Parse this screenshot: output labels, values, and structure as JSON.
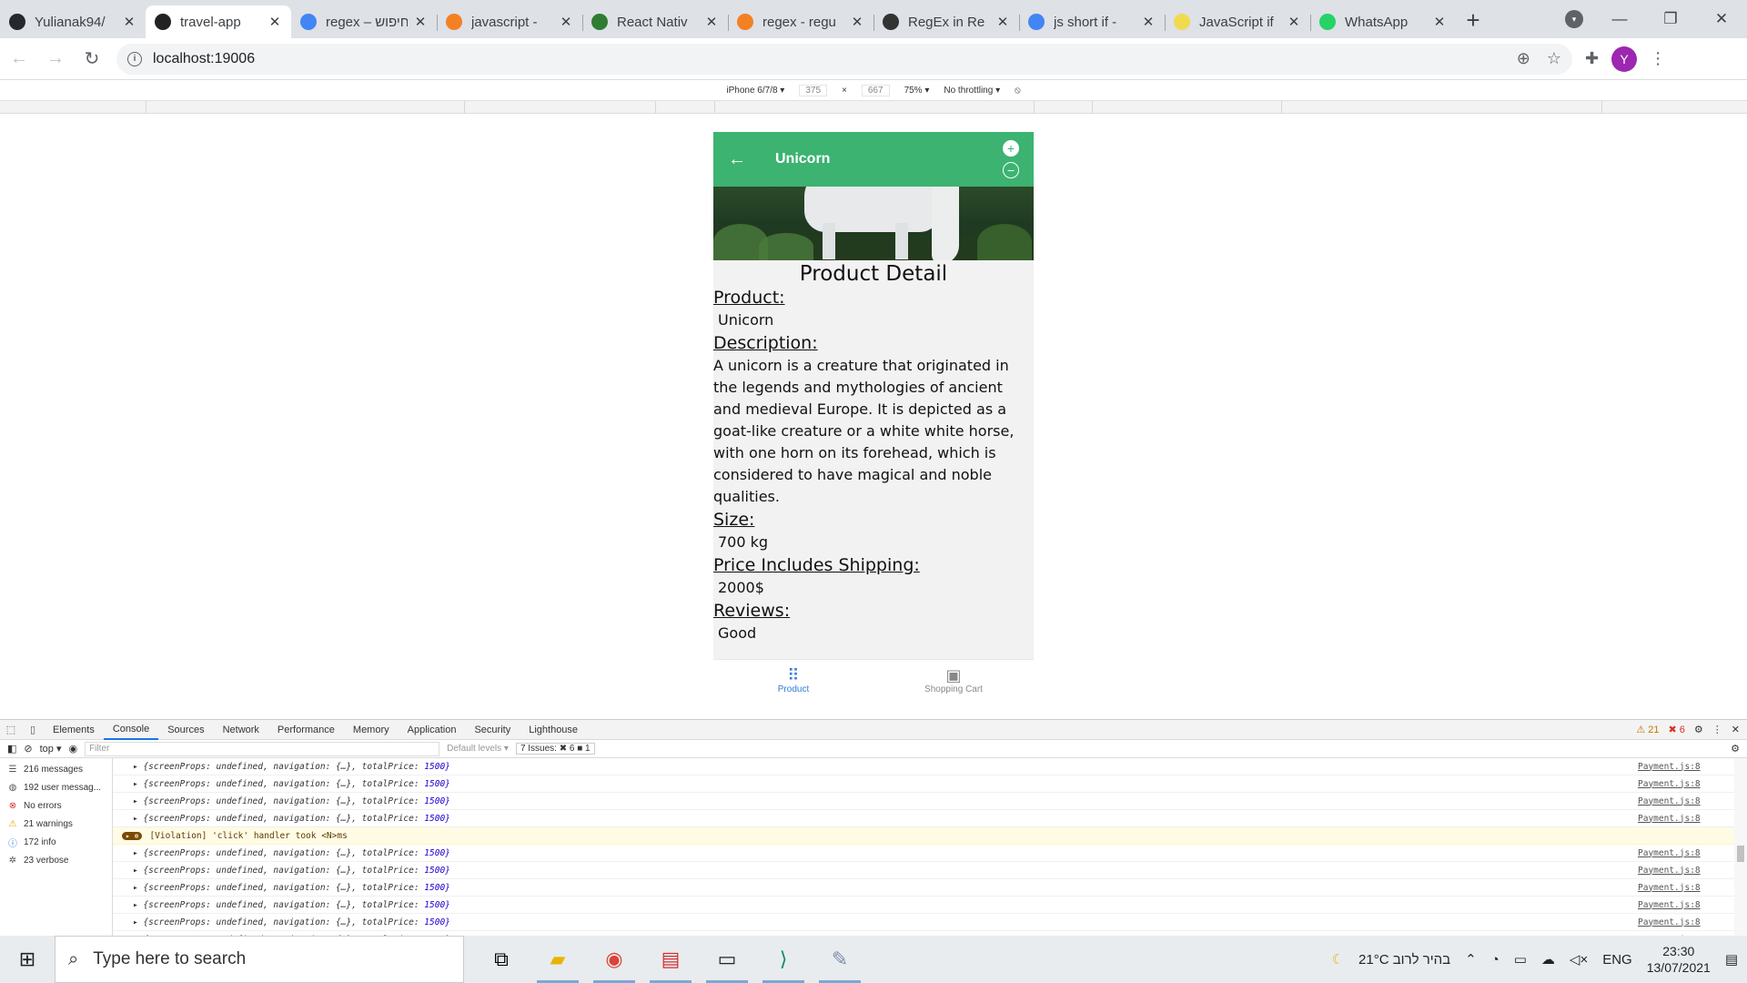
{
  "browser": {
    "tabs": [
      {
        "label": "Yulianak94/",
        "favicon_color": "#24292e",
        "favicon": "github-icon",
        "active": false
      },
      {
        "label": "travel-app",
        "favicon_color": "#222222",
        "favicon": "expo-icon",
        "active": true
      },
      {
        "label": "regex – חיפוש",
        "favicon_color": "#4285f4",
        "favicon": "google-icon",
        "active": false
      },
      {
        "label": "javascript -",
        "favicon_color": "#f48024",
        "favicon": "stackoverflow-icon",
        "active": false
      },
      {
        "label": "React Nativ",
        "favicon_color": "#2e7d32",
        "favicon": "mail-icon",
        "active": false
      },
      {
        "label": "regex - regu",
        "favicon_color": "#f48024",
        "favicon": "stackoverflow-icon",
        "active": false
      },
      {
        "label": "RegEx in Re",
        "favicon_color": "#333333",
        "favicon": "diamond-icon",
        "active": false
      },
      {
        "label": "js short if -",
        "favicon_color": "#4285f4",
        "favicon": "google-icon",
        "active": false
      },
      {
        "label": "JavaScript if",
        "favicon_color": "#f0db4f",
        "favicon": "js-icon",
        "active": false
      },
      {
        "label": "WhatsApp",
        "favicon_color": "#25d366",
        "favicon": "whatsapp-icon",
        "active": false
      }
    ],
    "url": "localhost:19006",
    "profile_initial": "Y"
  },
  "device_toolbar": {
    "device": "iPhone 6/7/8 ▾",
    "width": "375",
    "height": "667",
    "zoom": "75% ▾",
    "throttling": "No throttling ▾"
  },
  "app": {
    "header_title": "Unicorn",
    "page_title": "Product Detail",
    "product_label": "Product:",
    "product_value": "Unicorn",
    "description_label": "Description:",
    "description_value": "A unicorn is a creature that originated in the legends and mythologies of ancient and medieval Europe. It is depicted as a goat-like creature or a white white horse, with one horn on its forehead, which is considered to have magical and noble qualities.",
    "size_label": "Size:",
    "size_value": "700 kg",
    "price_label": "Price Includes Shipping:",
    "price_value": "2000$",
    "reviews_label": "Reviews:",
    "reviews_value": "Good",
    "tabs": [
      {
        "label": "Product",
        "icon": "grid-icon",
        "active": true
      },
      {
        "label": "Shopping Cart",
        "icon": "archive-icon",
        "active": false
      }
    ],
    "accent_color": "#3cb371"
  },
  "devtools": {
    "tabs": [
      "Elements",
      "Console",
      "Sources",
      "Network",
      "Performance",
      "Memory",
      "Application",
      "Security",
      "Lighthouse"
    ],
    "active_tab": "Console",
    "warnings_badge": "⚠ 21",
    "errors_badge": "✖ 6",
    "context": "top ▾",
    "filter_placeholder": "Filter",
    "levels": "Default levels ▾",
    "issues": "7 Issues: ✖ 6 ■ 1",
    "sidebar": [
      {
        "label": "216 messages",
        "icon": "list-icon"
      },
      {
        "label": "192 user messag...",
        "icon": "user-icon"
      },
      {
        "label": "No errors",
        "icon": "error-icon"
      },
      {
        "label": "21 warnings",
        "icon": "warning-icon"
      },
      {
        "label": "172 info",
        "icon": "info-icon"
      },
      {
        "label": "23 verbose",
        "icon": "bug-icon"
      }
    ],
    "log_prefix": "▸ {screenProps: undefined, navigation: {…}, totalPrice: ",
    "log_value": "1500}",
    "log_source": "Payment.js:8",
    "violation_badge": "▸ ⊗",
    "violation_text": "[Violation] 'click' handler took <N>ms"
  },
  "taskbar": {
    "search_placeholder": "Type here to search",
    "weather": "21°C בהיר לרוב",
    "language": "ENG",
    "time": "23:30",
    "date": "13/07/2021"
  }
}
